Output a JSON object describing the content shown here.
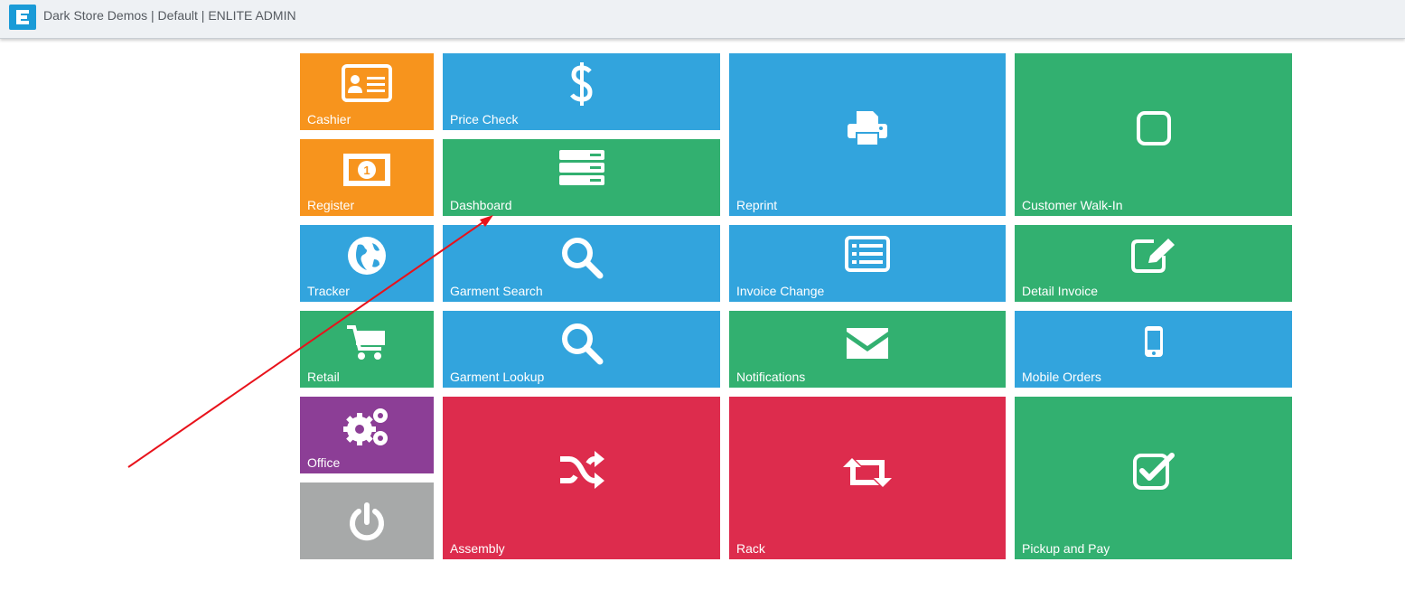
{
  "header": {
    "title": "Dark Store Demos | Default | ENLITE ADMIN",
    "logo_icon": "enlite-logo-icon"
  },
  "tiles": {
    "cashier": {
      "label": "Cashier",
      "icon": "id-card-icon",
      "color": "#f7941d"
    },
    "register": {
      "label": "Register",
      "icon": "money-bill-icon",
      "color": "#f7941d"
    },
    "tracker": {
      "label": "Tracker",
      "icon": "globe-icon",
      "color": "#32a4dd"
    },
    "retail": {
      "label": "Retail",
      "icon": "shopping-cart-icon",
      "color": "#32b070"
    },
    "office": {
      "label": "Office",
      "icon": "gears-icon",
      "color": "#8c3e96"
    },
    "power": {
      "label": "",
      "icon": "power-icon",
      "color": "#a7a9a9"
    },
    "price_check": {
      "label": "Price Check",
      "icon": "dollar-icon",
      "color": "#32a4dd"
    },
    "dashboard": {
      "label": "Dashboard",
      "icon": "server-icon",
      "color": "#32b070"
    },
    "garment_search": {
      "label": "Garment Search",
      "icon": "search-icon",
      "color": "#32a4dd"
    },
    "garment_lookup": {
      "label": "Garment Lookup",
      "icon": "search-icon",
      "color": "#32a4dd"
    },
    "assembly": {
      "label": "Assembly",
      "icon": "shuffle-icon",
      "color": "#dd2c4d"
    },
    "reprint": {
      "label": "Reprint",
      "icon": "print-icon",
      "color": "#32a4dd"
    },
    "invoice_change": {
      "label": "Invoice Change",
      "icon": "list-alt-icon",
      "color": "#32a4dd"
    },
    "notifications": {
      "label": "Notifications",
      "icon": "envelope-icon",
      "color": "#32b070"
    },
    "rack": {
      "label": "Rack",
      "icon": "retweet-icon",
      "color": "#dd2c4d"
    },
    "customer_walk_in": {
      "label": "Customer Walk-In",
      "icon": "square-outline-icon",
      "color": "#32b070"
    },
    "detail_invoice": {
      "label": "Detail Invoice",
      "icon": "edit-icon",
      "color": "#32b070"
    },
    "mobile_orders": {
      "label": "Mobile Orders",
      "icon": "mobile-phone-icon",
      "color": "#32a4dd"
    },
    "pickup_and_pay": {
      "label": "Pickup and Pay",
      "icon": "check-square-icon",
      "color": "#32b070"
    }
  },
  "annotation": {
    "arrow_color": "#e8121b"
  }
}
